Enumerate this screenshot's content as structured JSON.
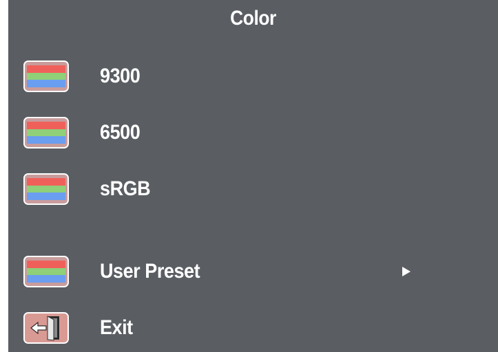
{
  "title": "Color",
  "colors": {
    "background": "#5a5e63",
    "text": "#ffffff",
    "swatch_red": "#f0605a",
    "swatch_green": "#8fd078",
    "swatch_blue": "#6a9ef0",
    "icon_frame": "#c99c9c"
  },
  "items": [
    {
      "label": "9300",
      "icon": "color-swatch-icon"
    },
    {
      "label": "6500",
      "icon": "color-swatch-icon"
    },
    {
      "label": "sRGB",
      "icon": "color-swatch-icon"
    },
    {
      "label": "User Preset",
      "icon": "color-swatch-icon",
      "submenu": true,
      "submenu_icon": "arrow-right-icon"
    },
    {
      "label": "Exit",
      "icon": "exit-door-icon"
    }
  ]
}
